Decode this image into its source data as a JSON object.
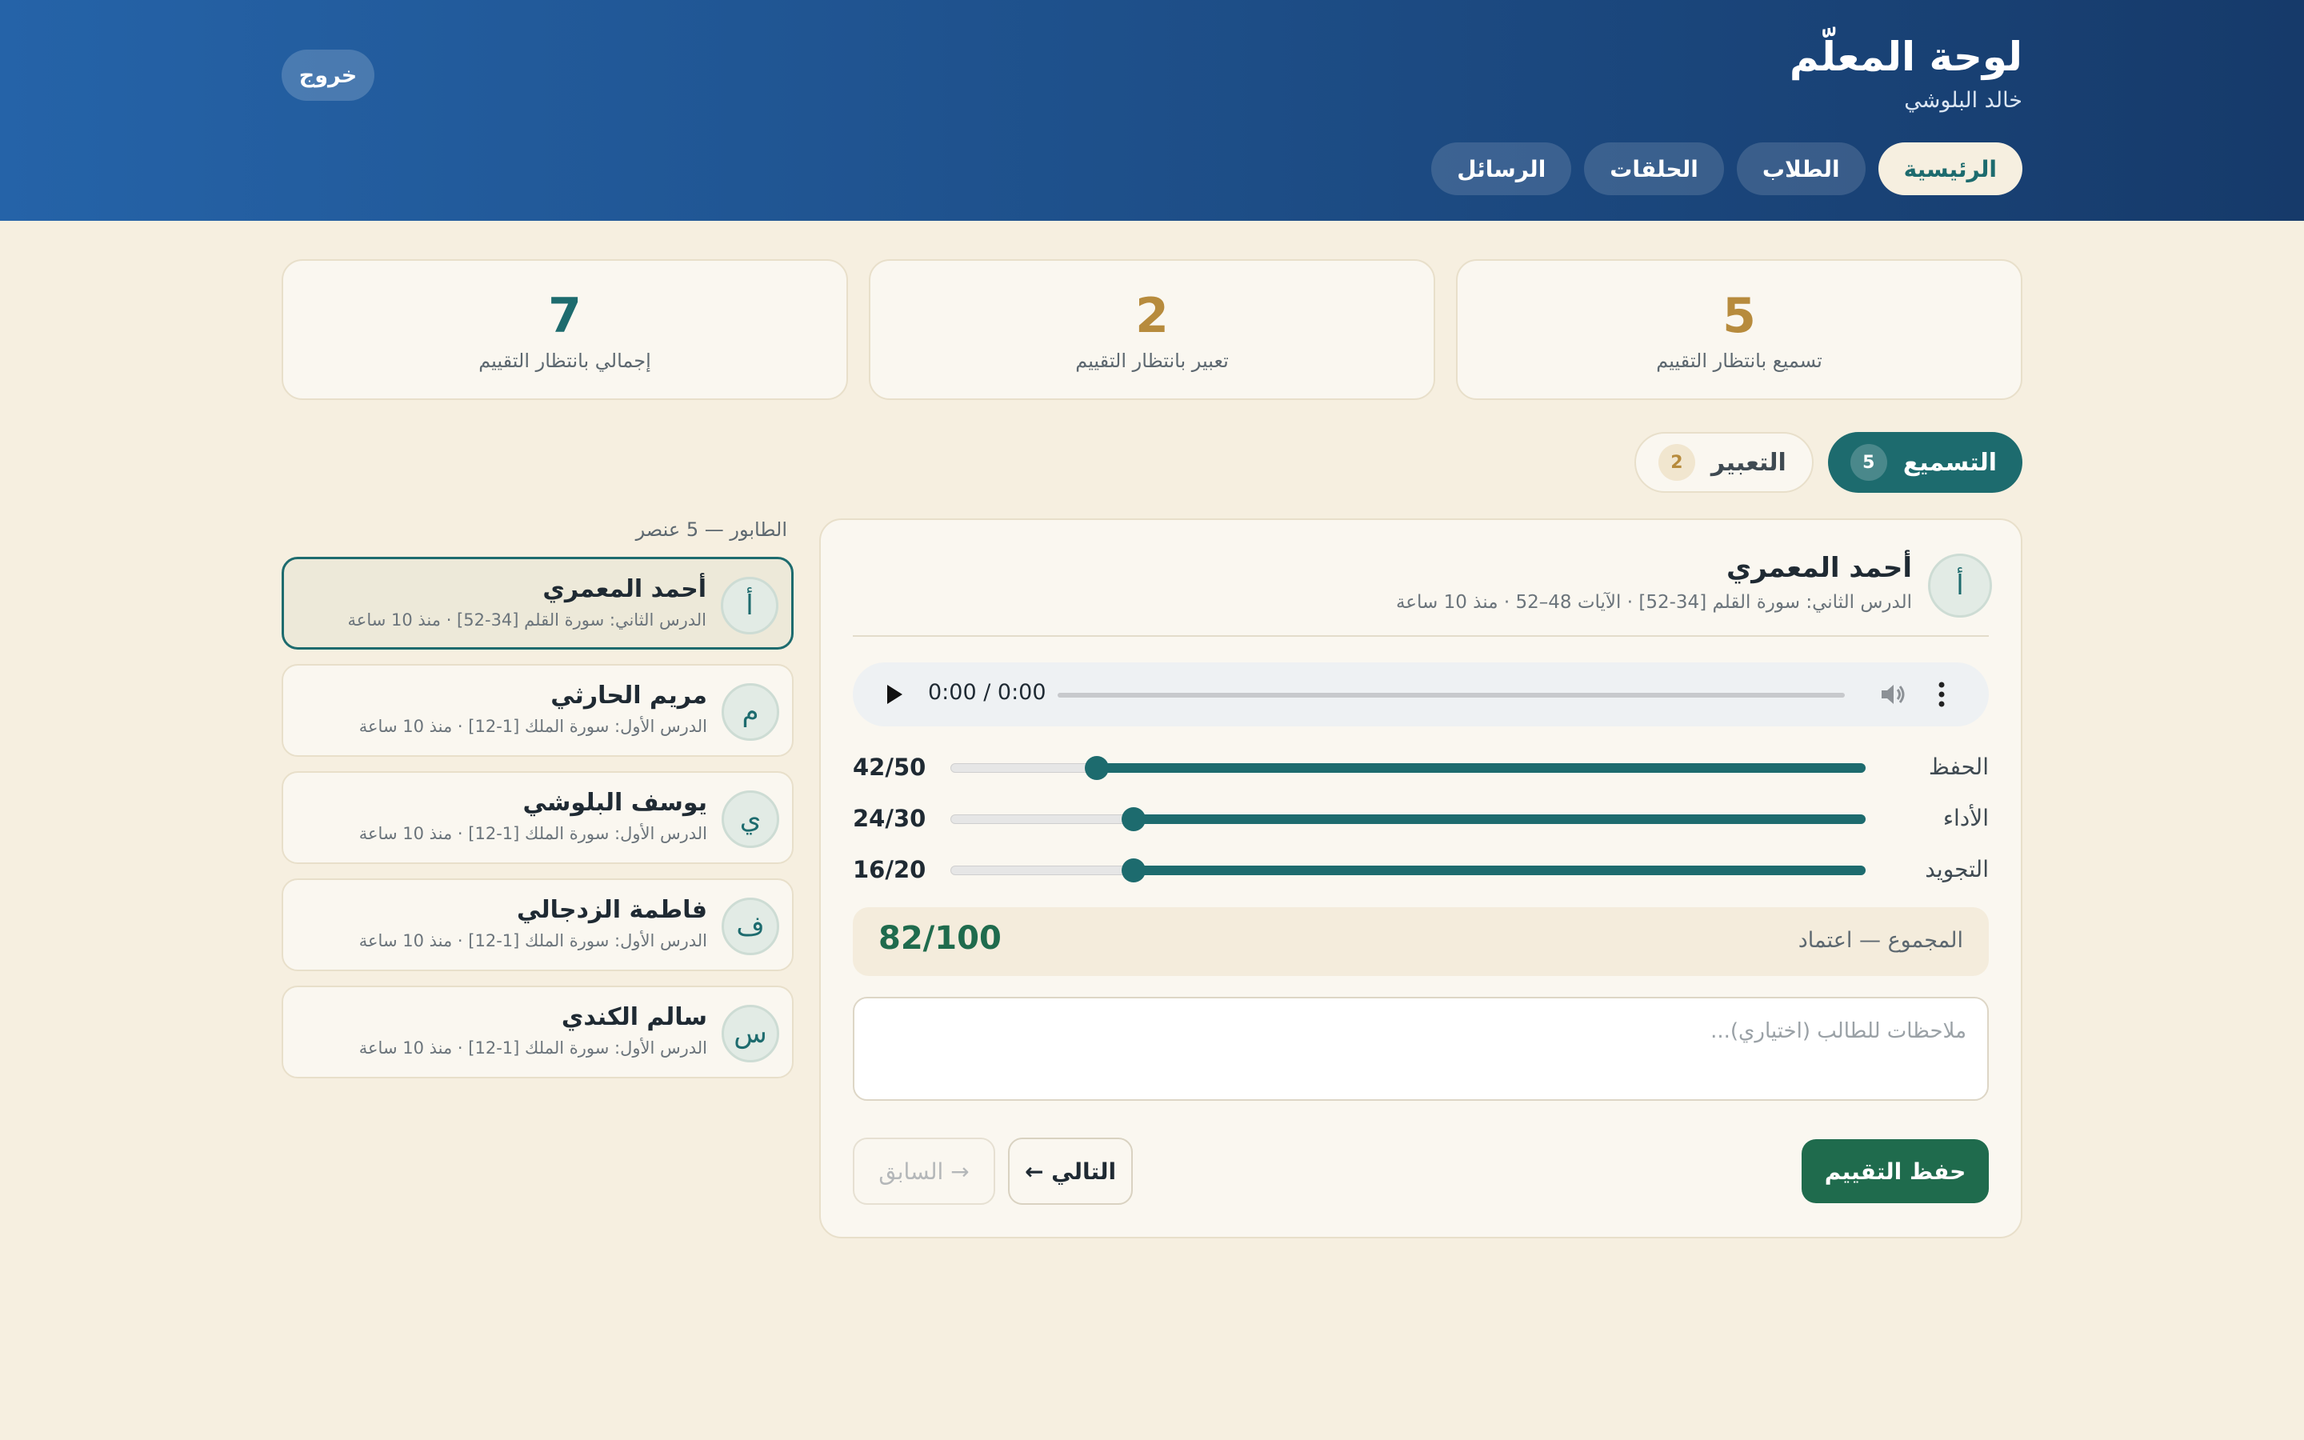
{
  "header": {
    "title": "لوحة المعلّم",
    "teacher_name": "خالد البلوشي",
    "logout_label": "خروج",
    "nav": [
      {
        "label": "الرئيسية",
        "active": true
      },
      {
        "label": "الطلاب",
        "active": false
      },
      {
        "label": "الحلقات",
        "active": false
      },
      {
        "label": "الرسائل",
        "active": false
      }
    ]
  },
  "stats": [
    {
      "value": "5",
      "label": "تسميع بانتظار التقييم",
      "color": "#b78b3d"
    },
    {
      "value": "2",
      "label": "تعبير بانتظار التقييم",
      "color": "#b78b3d"
    },
    {
      "value": "7",
      "label": "إجمالي بانتظار التقييم",
      "color": "#1d6b6e"
    }
  ],
  "tabs": [
    {
      "label": "التسميع",
      "count": "5",
      "active": true
    },
    {
      "label": "التعبير",
      "count": "2",
      "active": false
    }
  ],
  "queue": {
    "title": "الطابور — 5 عنصر",
    "items": [
      {
        "initial": "أ",
        "name": "أحمد المعمري",
        "meta": "الدرس الثاني: سورة القلم [34-52] · منذ 10 ساعة",
        "active": true
      },
      {
        "initial": "م",
        "name": "مريم الحارثي",
        "meta": "الدرس الأول: سورة الملك [1-12] · منذ 10 ساعة",
        "active": false
      },
      {
        "initial": "ي",
        "name": "يوسف البلوشي",
        "meta": "الدرس الأول: سورة الملك [1-12] · منذ 10 ساعة",
        "active": false
      },
      {
        "initial": "ف",
        "name": "فاطمة الزدجالي",
        "meta": "الدرس الأول: سورة الملك [1-12] · منذ 10 ساعة",
        "active": false
      },
      {
        "initial": "س",
        "name": "سالم الكندي",
        "meta": "الدرس الأول: سورة الملك [1-12] · منذ 10 ساعة",
        "active": false
      }
    ]
  },
  "review": {
    "student_initial": "أ",
    "student_name": "أحمد المعمري",
    "meta": "الدرس الثاني: سورة القلم [34-52] · الآيات 48–52 · منذ 10 ساعة",
    "audio": {
      "time": "0:00 / 0:00",
      "progress": 0
    },
    "scores": [
      {
        "label": "الحفظ",
        "value": 42,
        "max": 50,
        "display": "42/50"
      },
      {
        "label": "الأداء",
        "value": 24,
        "max": 30,
        "display": "24/30"
      },
      {
        "label": "التجويد",
        "value": 16,
        "max": 20,
        "display": "16/20"
      }
    ],
    "total_label": "المجموع — اعتماد",
    "total_value": "82/100",
    "notes_placeholder": "ملاحظات للطالب (اختياري)...",
    "save_label": "حفظ التقييم",
    "next_label": "التالي ←",
    "prev_label": "→ السابق"
  },
  "icons": {
    "play": "play-icon",
    "volume": "volume-icon",
    "more": "more-vertical-icon"
  }
}
